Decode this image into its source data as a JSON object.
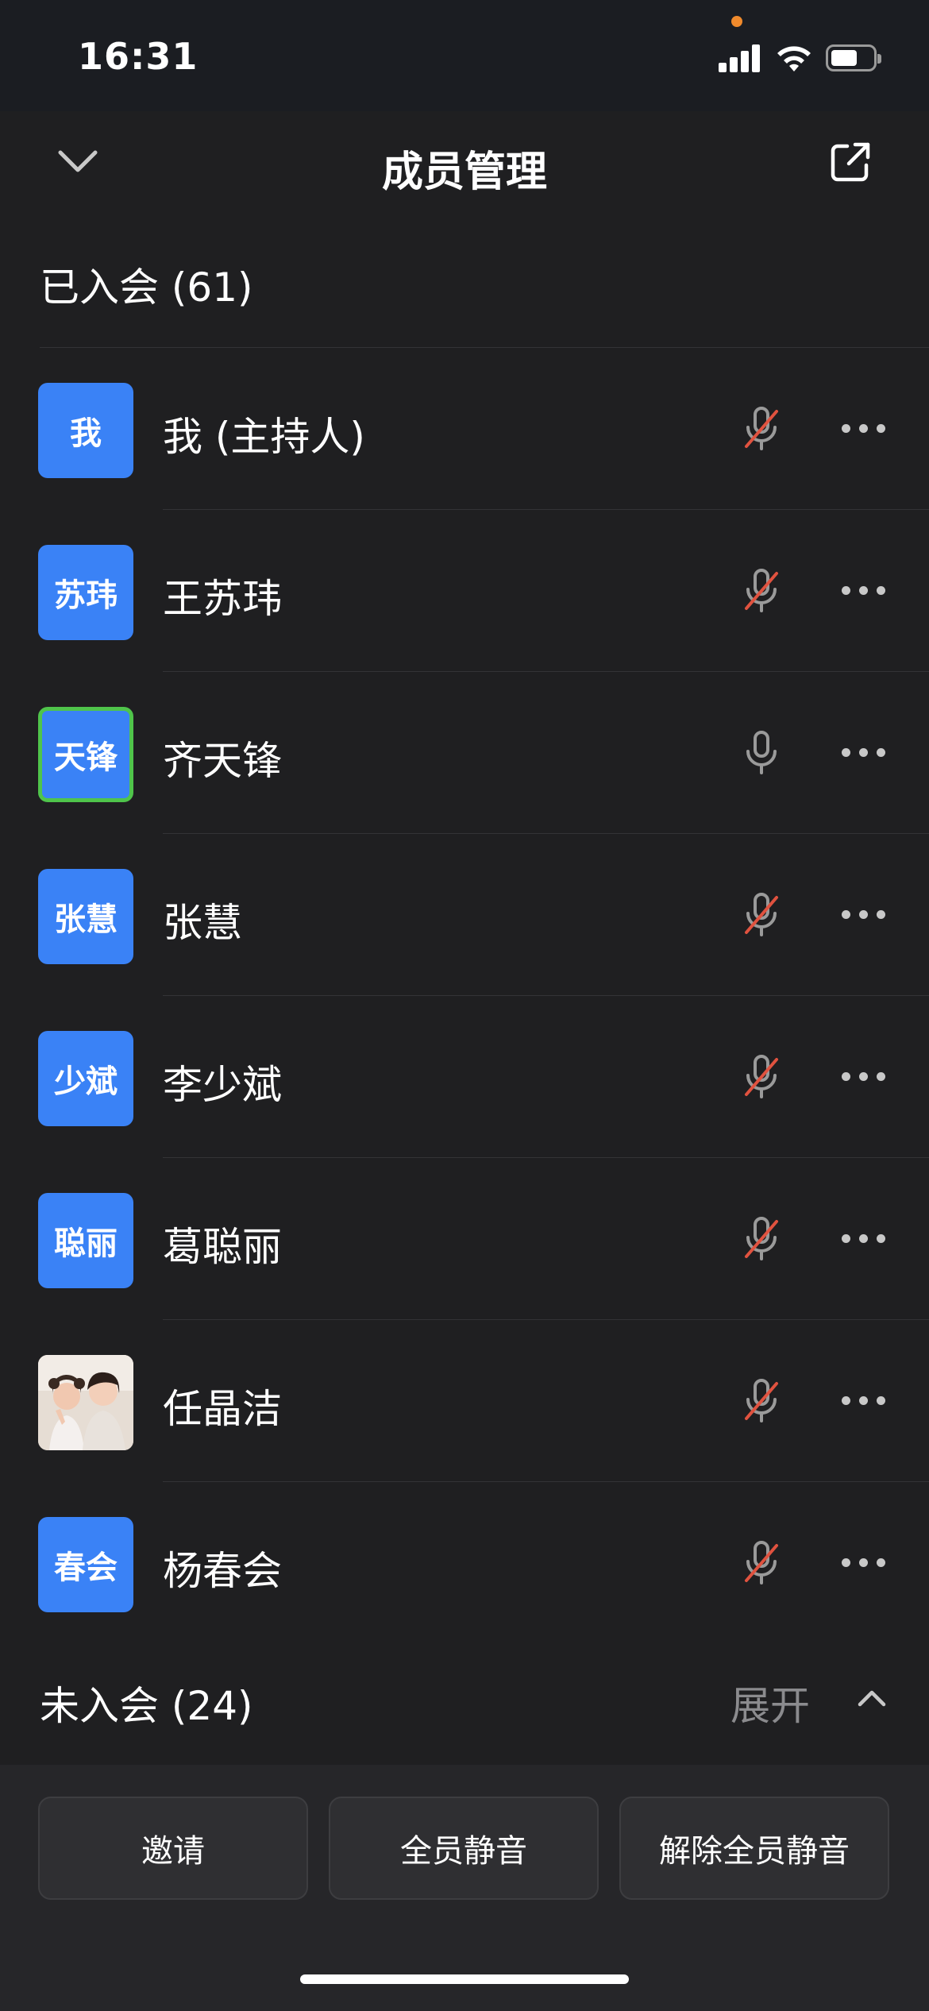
{
  "status_bar": {
    "time": "16:31"
  },
  "header": {
    "title": "成员管理"
  },
  "joined_section": {
    "label": "已入会 (61)"
  },
  "members": [
    {
      "avatar_text": "我",
      "name": "我 (主持人)",
      "mic": "mic-muted-icon"
    },
    {
      "avatar_text": "苏玮",
      "name": "王苏玮",
      "mic": "mic-muted-icon"
    },
    {
      "avatar_text": "天锋",
      "name": "齐天锋",
      "mic": "mic-icon",
      "speaking": true
    },
    {
      "avatar_text": "张慧",
      "name": "张慧",
      "mic": "mic-muted-icon"
    },
    {
      "avatar_text": "少斌",
      "name": "李少斌",
      "mic": "mic-muted-icon"
    },
    {
      "avatar_text": "聪丽",
      "name": "葛聪丽",
      "mic": "mic-muted-icon"
    },
    {
      "avatar_text": "",
      "name": "任晶洁",
      "mic": "mic-muted-icon",
      "avatar_photo": true
    },
    {
      "avatar_text": "春会",
      "name": "杨春会",
      "mic": "mic-muted-icon"
    }
  ],
  "not_joined_section": {
    "label": "未入会 (24)",
    "expand_label": "展开"
  },
  "actions": {
    "invite": "邀请",
    "mute_all": "全员静音",
    "unmute_all": "解除全员静音"
  },
  "colors": {
    "avatar_blue": "#3a82f6",
    "speaking_green": "#4fc44b",
    "muted_red": "#e0523f",
    "background": "#1f1f21"
  }
}
